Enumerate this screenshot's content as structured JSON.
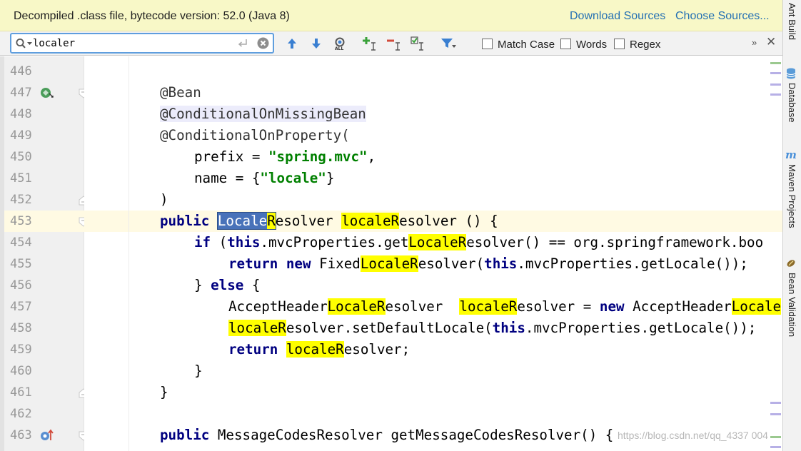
{
  "banner": {
    "message": "Decompiled .class file, bytecode version: 52.0 (Java 8)",
    "download_sources": "Download Sources",
    "choose_sources": "Choose Sources..."
  },
  "search": {
    "query": "localer",
    "options": {
      "match_case": "Match Case",
      "words": "Words",
      "regex": "Regex"
    },
    "match_case_checked": false,
    "words_checked": false,
    "regex_checked": false,
    "more": "»",
    "close": "✕"
  },
  "toolbar_icons": [
    "search-history-icon",
    "enter-icon",
    "clear-search-icon",
    "previous-occurrence-icon",
    "next-occurrence-icon",
    "select-all-occurrences-icon",
    "add-occurrence-icon",
    "remove-occurrence-icon",
    "select-all-matches-icon",
    "filter-icon"
  ],
  "line_numbers": [
    "446",
    "447",
    "448",
    "449",
    "450",
    "451",
    "452",
    "453",
    "454",
    "455",
    "456",
    "457",
    "458",
    "459",
    "460",
    "461",
    "462",
    "463"
  ],
  "current_line": "453",
  "code": {
    "l447": "@Bean",
    "l448": "@ConditionalOnMissingBean",
    "l449": "@ConditionalOnProperty(",
    "l450_a": "prefix = ",
    "l450_s": "\"spring.mvc\"",
    "l450_b": ",",
    "l451_a": "name = {",
    "l451_s": "\"locale\"",
    "l451_b": "}",
    "l452": ")",
    "kw_public": "public",
    "kw_if": "if",
    "kw_this": "this",
    "kw_return": "return",
    "kw_new": "new",
    "kw_else": "else",
    "match": "localeR",
    "match_cap": "LocaleR",
    "match_cap_cur_a": "Locale",
    "match_cap_cur_b": "R",
    "resolver_rest": "esolver",
    "l453_c": " () {",
    "l454_a": " (",
    "l454_b": ".mvcProperties.get",
    "l454_c": "esolver() == org.springframework.boo",
    "l455_a": " Fixed",
    "l455_b": "esolver(",
    "l455_c": ".mvcProperties.getLocale());",
    "l456_a": "} ",
    "l456_b": " {",
    "l457_a": "AcceptHeader",
    "l457_b": "esolver ",
    "l457_c": "esolver = ",
    "l457_d": " AcceptHeader",
    "l457_e": "Locale",
    "l458_a": "esolver.setDefaultLocale(",
    "l458_b": ".mvcProperties.getLocale());",
    "l459_a": " ",
    "l459_b": "esolver;",
    "l460": "}",
    "l461": "}",
    "l463_a": " MessageCodesResolver getMessageCodesResolver() {"
  },
  "tool_windows": [
    "Ant Build",
    "Database",
    "Maven Projects",
    "Bean Validation"
  ],
  "watermark": "https://blog.csdn.net/qq_4337 004",
  "colors": {
    "banner_bg": "#f8f8c7",
    "link": "#2470b3",
    "search_border": "#5f9ede",
    "keyword": "#000080",
    "string": "#008000",
    "highlight": "#ffff00",
    "current_match": "#4872b9",
    "caret_row": "#fffae3",
    "annotation_highlight": "#ececfb"
  }
}
